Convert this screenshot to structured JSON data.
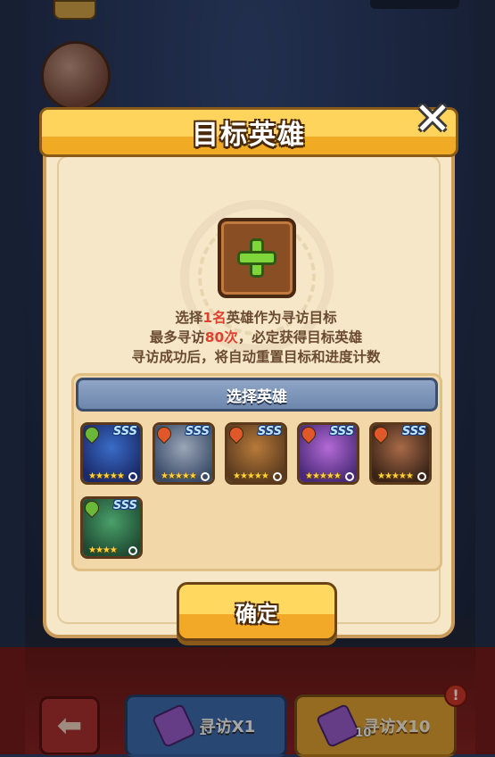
{
  "dialog": {
    "title": "目标英雄",
    "close_icon": "close-icon",
    "desc": {
      "line1_pre": "选择",
      "line1_hl": "1名",
      "line1_post": "英雄作为寻访目标",
      "line2_pre": "最多寻访",
      "line2_hl": "80次",
      "line2_post": "，必定获得目标英雄",
      "line3": "寻访成功后，将自动重置目标和进度计数"
    },
    "panel_title": "选择英雄",
    "confirm_label": "确定",
    "heroes": [
      {
        "grade": "SSS",
        "stars": "★★★★★",
        "element": "leaf",
        "colors": [
          "#3a6cc8",
          "#1a2a6a"
        ]
      },
      {
        "grade": "SSS",
        "stars": "★★★★★",
        "element": "fire",
        "colors": [
          "#9aa6b8",
          "#3a4a68"
        ]
      },
      {
        "grade": "SSS",
        "stars": "★★★★★",
        "element": "fire",
        "colors": [
          "#b87a3a",
          "#5a3a1e"
        ]
      },
      {
        "grade": "SSS",
        "stars": "★★★★★",
        "element": "fire",
        "colors": [
          "#b46ad6",
          "#4a2a78"
        ]
      },
      {
        "grade": "SSS",
        "stars": "★★★★★",
        "element": "fire",
        "colors": [
          "#a86a48",
          "#3a2418"
        ]
      },
      {
        "grade": "SSS",
        "stars": "★★★★",
        "element": "leaf",
        "colors": [
          "#4aa06a",
          "#1e4a32"
        ]
      }
    ]
  },
  "bottom": {
    "visit_x1": {
      "label": "寻访X1",
      "count": "1"
    },
    "visit_x10": {
      "label": "寻访X10",
      "count": "10"
    },
    "alert": "!"
  },
  "colors": {
    "fire": "#e0582a",
    "leaf": "#6ab83a",
    "accent": "#f0aa24"
  }
}
